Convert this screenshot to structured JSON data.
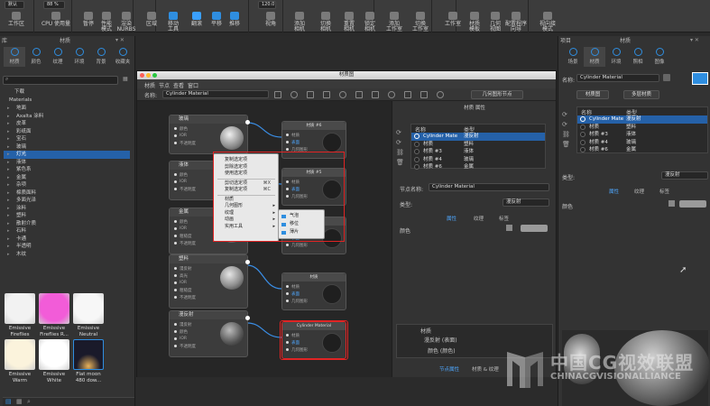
{
  "toolbar": {
    "preset_label": "默认",
    "zoom_value": "88 %",
    "viewport_value": "120.0",
    "buttons": [
      {
        "label": "工作区",
        "icon": "workspace-icon"
      },
      {
        "label": "CPU 使用量",
        "icon": "cpu-icon"
      },
      {
        "label": "暂停",
        "icon": "pause-icon"
      },
      {
        "label": "性能\n模式",
        "icon": "performance-icon"
      },
      {
        "label": "渲染\nNURBS",
        "icon": "nurbs-icon"
      },
      {
        "label": "区域",
        "icon": "region-icon"
      },
      {
        "label": "移动\n工具",
        "icon": "move-tool-icon"
      },
      {
        "label": "翻滚",
        "icon": "tumble-icon"
      },
      {
        "label": "平移",
        "icon": "pan-icon"
      },
      {
        "label": "推移",
        "icon": "dolly-icon"
      },
      {
        "label": "视角",
        "icon": "fov-icon"
      },
      {
        "label": "添加\n相机",
        "icon": "add-camera-icon"
      },
      {
        "label": "切换\n相机",
        "icon": "switch-camera-icon"
      },
      {
        "label": "重置\n相机",
        "icon": "reset-camera-icon"
      },
      {
        "label": "锁定\n相机",
        "icon": "lock-camera-icon"
      },
      {
        "label": "添加\n工作室",
        "icon": "add-studio-icon"
      },
      {
        "label": "切换\n工作室",
        "icon": "switch-studio-icon"
      },
      {
        "label": "工作室",
        "icon": "studio-icon"
      },
      {
        "label": "材质\n模板",
        "icon": "material-template-icon"
      },
      {
        "label": "几何\n视图",
        "icon": "geometry-view-icon"
      },
      {
        "label": "配置程序\n向导",
        "icon": "configurator-icon"
      },
      {
        "label": "视向接\n模式",
        "icon": "view-mode-icon"
      }
    ]
  },
  "left_panel": {
    "tabs": [
      "库",
      "材质"
    ],
    "categories": [
      "材质",
      "颜色",
      "纹理",
      "环境",
      "背景",
      "收藏夹"
    ],
    "tree_root": "下载",
    "tree_group": "Materials",
    "tree_items": [
      "地面",
      "Axalta 涂料",
      "皮革",
      "彩纸面",
      "宝石",
      "玻璃",
      "灯光",
      "液体",
      "紫色系",
      "金属",
      "杂项",
      "棉质面料",
      "多面光泽",
      "涂料",
      "塑料",
      "散射介质",
      "石料",
      "卡通",
      "半透明",
      "木纹"
    ],
    "selected_item": "灯光",
    "swatches": [
      {
        "name": "Emissive\nFireflies",
        "color": "#f2f2f2"
      },
      {
        "name": "Emissive\nFireflies R...",
        "color": "#f25cd8"
      },
      {
        "name": "Emissive\nNeutral",
        "color": "#f7f7f7"
      },
      {
        "name": "Emissive\nWarm",
        "color": "#fbf3dc"
      },
      {
        "name": "Emissive\nWhite",
        "color": "#ffffff"
      },
      {
        "name": "Flat moon\n480 dow...",
        "color": "#1a1a2a"
      }
    ]
  },
  "material_editor": {
    "window_title": "材质图",
    "menu": [
      "材质",
      "节点",
      "查看",
      "窗口"
    ],
    "name_label": "名称:",
    "material_name": "Cylinder Material",
    "geometry_button": "几何图形节点",
    "nodes": [
      {
        "title": "玻璃",
        "ports": [
          "颜色",
          "IOR",
          "不透明度"
        ]
      },
      {
        "title": "液体",
        "ports": [
          "颜色",
          "IOR",
          "不透明度"
        ]
      },
      {
        "title": "金属",
        "ports": [
          "颜色",
          "IOR",
          "粗糙度",
          "不透明度"
        ]
      },
      {
        "title": "塑料",
        "ports": [
          "漫反射",
          "高光",
          "IOR",
          "粗糙度",
          "不透明度"
        ]
      },
      {
        "title": "漫反射",
        "ports": [
          "漫反射",
          "颜色",
          "IOR",
          "不透明度"
        ]
      }
    ],
    "material_nodes": [
      {
        "title": "材质 #6",
        "line1": "材质",
        "line2": "表面",
        "line3": "几何图形"
      },
      {
        "title": "材质 #5",
        "line1": "材质",
        "line2": "表面",
        "line3": "几何图形"
      },
      {
        "title": "材质 #4",
        "line1": "材质",
        "line2": "表面",
        "line3": "几何图形"
      },
      {
        "title": "材质",
        "line1": "材质",
        "line2": "表面",
        "line3": "几何图形"
      },
      {
        "title": "Cylinder Material",
        "line1": "材质",
        "line2": "表面",
        "line3": "几何图形"
      }
    ],
    "context_menu": [
      "复制选定项",
      "剪除选定项",
      "使用选定项",
      "剪切选定项",
      "复制选定项",
      "材质",
      "几何图形",
      "纹理",
      "动画",
      "实用工具"
    ],
    "context_shortcuts": [
      "",
      "",
      "",
      "⌘X",
      "⌘C",
      "",
      "",
      "",
      "",
      ""
    ],
    "submenu": [
      "气泡",
      "移位",
      "薄片"
    ],
    "attr_title": "材质 属性",
    "list_headers": [
      "名称",
      "类型"
    ],
    "list_rows": [
      {
        "name": "Cylinder Mate",
        "type": "漫反射"
      },
      {
        "name": "材质",
        "type": "塑料"
      },
      {
        "name": "材质 #3",
        "type": "液体"
      },
      {
        "name": "材质 #4",
        "type": "玻璃"
      },
      {
        "name": "材质 #6",
        "type": "金属"
      }
    ],
    "node_name_label": "节点名称:",
    "node_name_value": "Cylinder Material",
    "type_label": "类型:",
    "type_value": "漫反射",
    "subtabs": [
      "属性",
      "纹理",
      "标签"
    ],
    "color_label": "颜色",
    "bottom_header": "材质",
    "bottom_row1": "漫反射 (表面)",
    "bottom_row2": "颜色 (颜色)",
    "bottom_tabs": [
      "节点属性",
      "材质 & 纹理"
    ]
  },
  "right_panel": {
    "title": "项目",
    "tab2": "材质",
    "categories": [
      "场景",
      "材质",
      "环境",
      "照相",
      "图像"
    ],
    "name_label": "名称:",
    "name_value": "Cylinder Material",
    "btn_left": "材质图",
    "btn_right": "多层材质",
    "list_headers": [
      "名称",
      "类型"
    ],
    "list_rows": [
      {
        "name": "Cylinder Mate",
        "type": "漫反射"
      },
      {
        "name": "材质",
        "type": "塑料"
      },
      {
        "name": "材质 #3",
        "type": "液体"
      },
      {
        "name": "材质 #4",
        "type": "玻璃"
      },
      {
        "name": "材质 #6",
        "type": "金属"
      }
    ],
    "type_label": "类型:",
    "type_value": "漫反射",
    "subtabs": [
      "属性",
      "纹理",
      "标签"
    ],
    "color_label": "颜色"
  },
  "watermark": {
    "cn": "中国CG视效联盟",
    "en": "CHINACGVISIONALLIANCE"
  }
}
